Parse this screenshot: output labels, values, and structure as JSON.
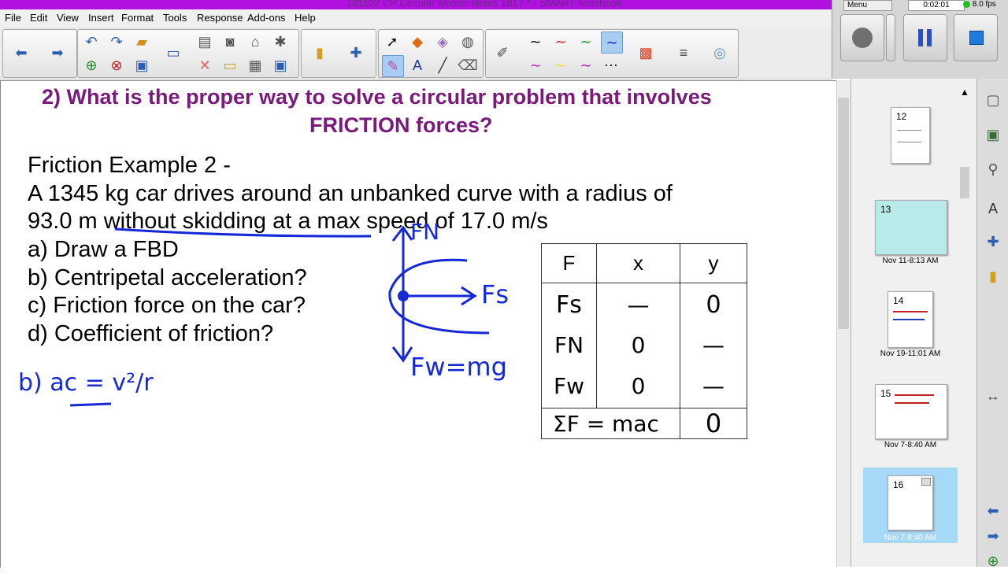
{
  "window": {
    "title": "181102 CP Circular Motion Notes 1817 * - SMART Notebook"
  },
  "recorder": {
    "menu_label": "Menu",
    "elapsed": "0:02:01",
    "fps": "8.0 fps"
  },
  "menubar": [
    "File",
    "Edit",
    "View",
    "Insert",
    "Format",
    "Tools",
    "Response",
    "Add-ons",
    "Help"
  ],
  "colors": {
    "title_purple": "#7a1a7a",
    "ink_blue": "#1428d8",
    "titlebar": "#b010e0"
  },
  "question": {
    "line1": "2) What is the proper way to solve a circular problem that involves",
    "line2": "FRICTION forces?"
  },
  "example": {
    "heading": "Friction Example 2 -",
    "problem_line1": "A 1345 kg car drives around an unbanked curve with a radius of",
    "problem_line2": "93.0 m without skidding at a max speed of 17.0 m/s",
    "parts": [
      "a) Draw a FBD",
      "b) Centripetal acceleration?",
      "c) Friction force on the car?",
      "d) Coefficient of friction?"
    ]
  },
  "handwriting": {
    "fbd_labels": {
      "normal": "FN",
      "friction": "Fs",
      "weight": "Fw=mg"
    },
    "formula": "b) ac = v²/r"
  },
  "force_table": {
    "headers": [
      "F",
      "x",
      "y"
    ],
    "rows": [
      [
        "Fs",
        "—",
        "0"
      ],
      [
        "FN",
        "0",
        "—"
      ],
      [
        "Fw",
        "0",
        "—"
      ]
    ],
    "sum_row": [
      "ΣF = mac",
      "0"
    ]
  },
  "pages": [
    {
      "number": "12",
      "caption": ""
    },
    {
      "number": "13",
      "caption": "Nov 11-8:13 AM"
    },
    {
      "number": "14",
      "caption": "Nov 19-11:01 AM"
    },
    {
      "number": "15",
      "caption": "Nov 7-8:40 AM"
    },
    {
      "number": "16",
      "caption": "Nov 7-8:40 AM"
    }
  ]
}
